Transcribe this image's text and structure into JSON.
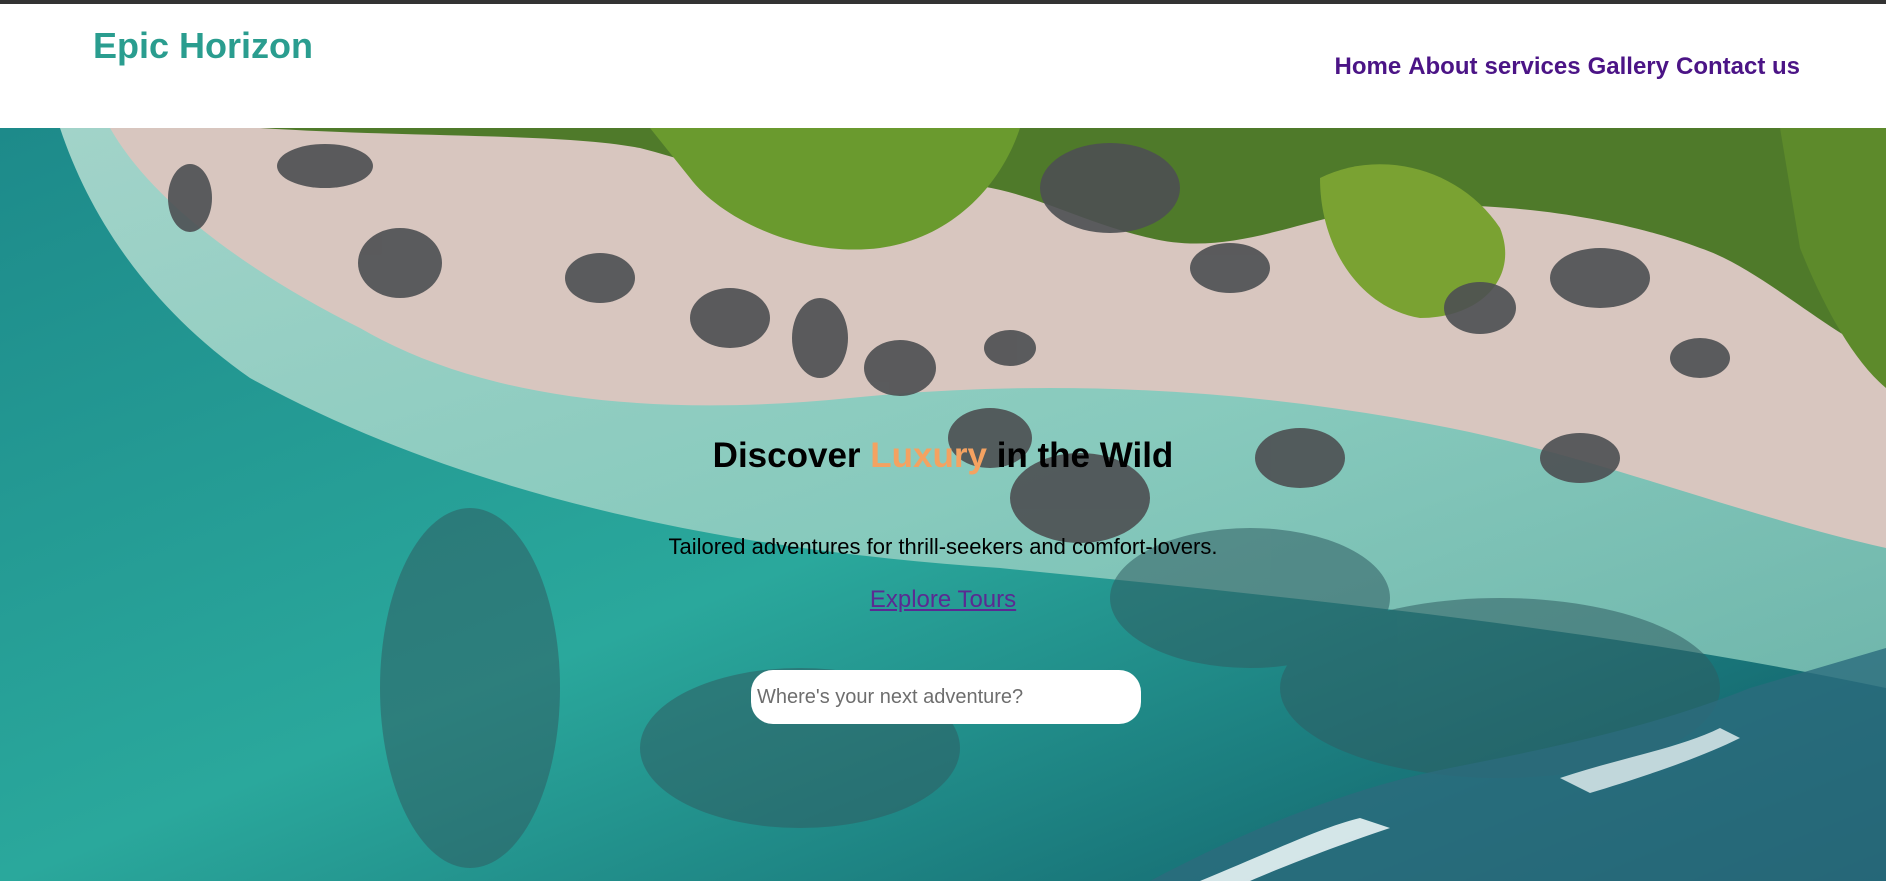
{
  "brand": {
    "name": "Epic Horizon",
    "color": "#2a9d8f"
  },
  "nav": {
    "color": "#4b1486",
    "items": [
      {
        "label": "Home"
      },
      {
        "label": "About"
      },
      {
        "label": "services"
      },
      {
        "label": "Gallery"
      },
      {
        "label": "Contact us"
      }
    ]
  },
  "hero": {
    "headline": {
      "before": "Discover ",
      "accent": "Luxury",
      "after": " in the Wild",
      "accent_color": "#f4a261"
    },
    "subtitle": "Tailored adventures for thrill-seekers and comfort-lovers.",
    "cta_label": "Explore Tours",
    "search": {
      "placeholder": "Where's your next adventure?",
      "value": ""
    },
    "background": "aerial-beach-photo"
  }
}
